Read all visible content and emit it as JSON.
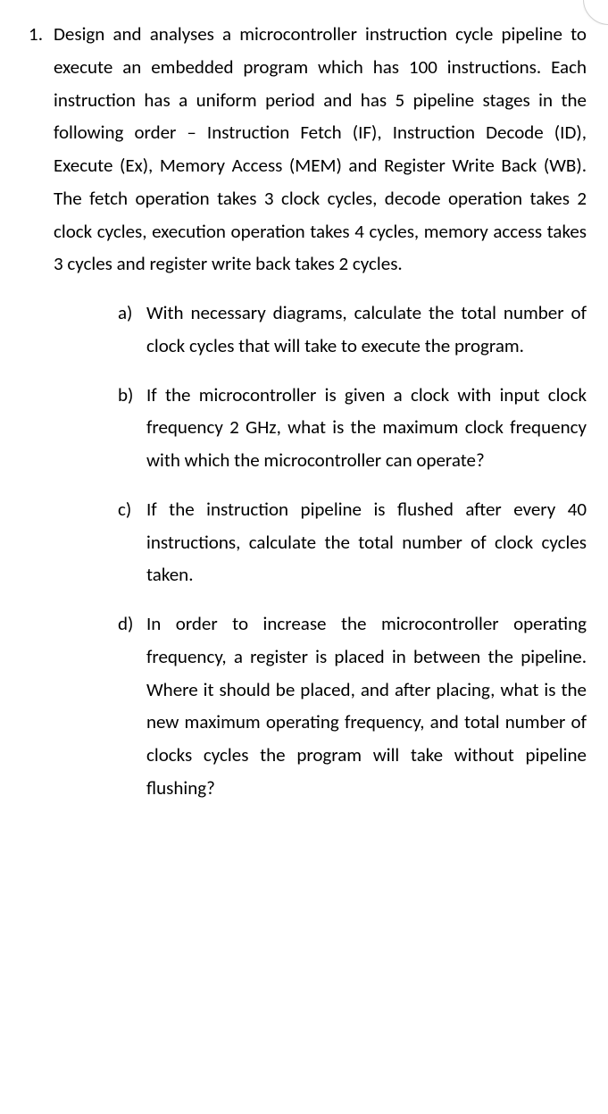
{
  "question": {
    "number": "1.",
    "stem": "Design and analyses a microcontroller instruction cycle pipeline to execute an embedded program which has 100 instructions. Each instruction has a uniform period and has 5 pipeline stages in the following order – Instruction Fetch (IF), Instruction Decode (ID), Execute (Ex), Memory Access (MEM) and Register Write Back (WB). The fetch operation takes 3 clock cycles, decode operation takes 2 clock cycles, execution operation takes 4 cycles, memory access takes 3 cycles and register write back takes 2 cycles.",
    "subparts": [
      {
        "label": "a)",
        "text": "With necessary diagrams, calculate the total number of clock cycles that will take to execute the program."
      },
      {
        "label": "b)",
        "text": "If the microcontroller is given a clock with input clock frequency 2 GHz, what is the maximum clock frequency with which the microcontroller can operate?"
      },
      {
        "label": "c)",
        "text": "If the instruction pipeline is flushed after every 40 instructions, calculate the total number of clock cycles taken."
      },
      {
        "label": "d)",
        "text": "In order to increase the microcontroller operating frequency, a register is placed in between the pipeline. Where it should be placed, and after placing, what is the new maximum operating frequency, and total number of clocks cycles the program will take without pipeline flushing?"
      }
    ]
  }
}
